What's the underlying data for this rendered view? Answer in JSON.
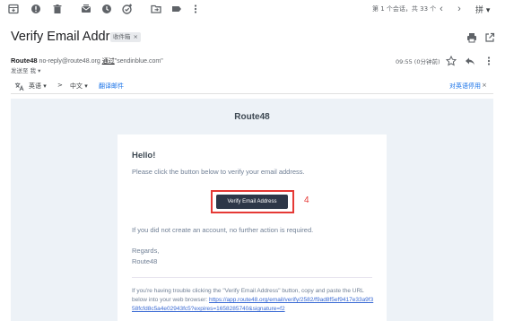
{
  "toolbar": {
    "icons": [
      "archive-icon",
      "report-spam-icon",
      "delete-icon",
      "mark-unread-icon",
      "snooze-icon",
      "add-task-icon",
      "move-to-icon",
      "label-icon",
      "more-icon"
    ],
    "pager_text": "第 1 个会话，共 33 个",
    "input_tool": "拼 ▾"
  },
  "message": {
    "subject": "Verify Email Address",
    "label_chip": "收件箱",
    "label_chip_close": "×",
    "sender_name": "Route48",
    "sender_email": "no-reply@route48.org",
    "via_text": "通过",
    "via_domain": "\"sendinblue.com\"",
    "to_text": "发送至 我 ▾",
    "time": "09:55 (0分钟前)"
  },
  "translate_bar": {
    "from_lang": "英语",
    "to_lang": "中文",
    "translate_link": "翻译邮件",
    "disable_link": "对英语停用",
    "arrow": ">",
    "close": "×"
  },
  "email": {
    "brand": "Route48",
    "greeting": "Hello!",
    "intro": "Please click the button below to verify your email address.",
    "button_label": "Verify Email Address",
    "annotation": "4",
    "no_action": "If you did not create an account, no further action is required.",
    "regards": "Regards,",
    "signature": "Route48",
    "trouble_text": "If you're having trouble clicking the \"Verify Email Address\" button, copy and paste the URL below into your web browser: ",
    "trouble_url": "https://app.route48.org/email/verify/2582/f9ad8f5ef9417e33a9f358fcfd8c5a4e02943fc5?expires=1658285740&signature=f2"
  },
  "colors": {
    "accent_link": "#1a73e8",
    "email_bg": "#edf2f7",
    "button_bg": "#2d3748",
    "annotation": "#e53935"
  }
}
